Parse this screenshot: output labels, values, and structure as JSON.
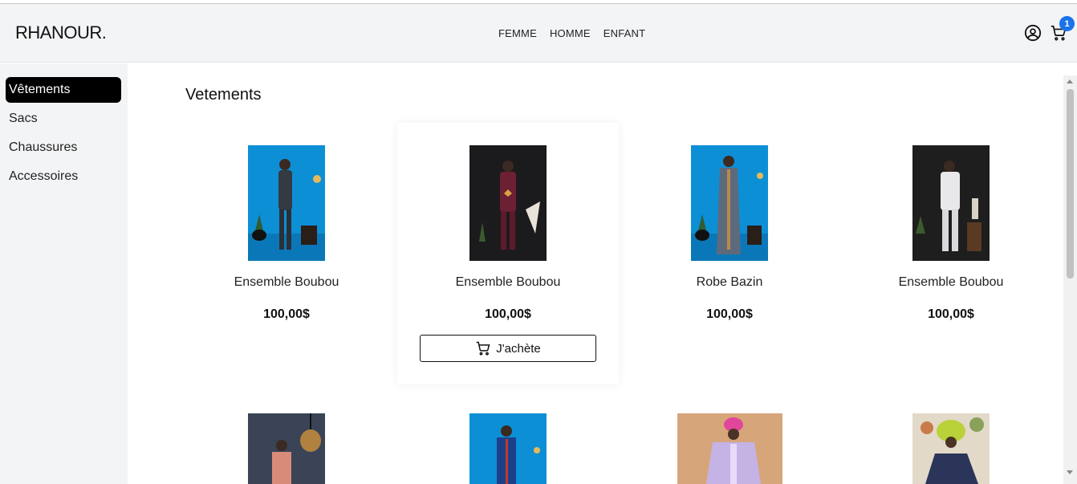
{
  "brand": {
    "logo": "RHANOUR."
  },
  "nav": {
    "items": [
      "FEMME",
      "HOMME",
      "ENFANT"
    ]
  },
  "header": {
    "cart_count": "1",
    "account_icon": "user-circle-icon",
    "cart_icon": "cart-icon"
  },
  "sidebar": {
    "items": [
      {
        "label": "Vêtements",
        "active": true
      },
      {
        "label": "Sacs",
        "active": false
      },
      {
        "label": "Chaussures",
        "active": false
      },
      {
        "label": "Accessoires",
        "active": false
      }
    ]
  },
  "main": {
    "title": "Vetements",
    "products": [
      {
        "name": "Ensemble Boubou",
        "price": "100,00$"
      },
      {
        "name": "Ensemble Boubou",
        "price": "100,00$",
        "hovered": true
      },
      {
        "name": "Robe Bazin",
        "price": "100,00$"
      },
      {
        "name": "Ensemble Boubou",
        "price": "100,00$"
      }
    ],
    "buy_label": "J'achète"
  },
  "colors": {
    "accent": "#1a73e8",
    "sidebar_bg": "#f3f4f6",
    "active_bg": "#000000"
  }
}
